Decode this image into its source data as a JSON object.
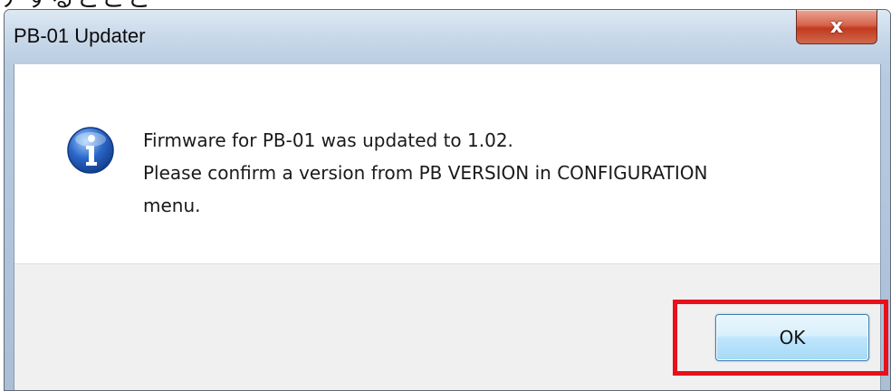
{
  "window": {
    "title": "PB-01 Updater",
    "close_glyph": "x"
  },
  "dialog": {
    "icon": "info-icon",
    "message_lines": [
      "Firmware for PB-01 was updated to 1.02.",
      "Please confirm a version from PB VERSION in CONFIGURATION",
      "menu."
    ]
  },
  "buttons": {
    "ok_label": "OK"
  },
  "colors": {
    "highlight": "#e8101a",
    "info_blue": "#2a66c8"
  }
}
